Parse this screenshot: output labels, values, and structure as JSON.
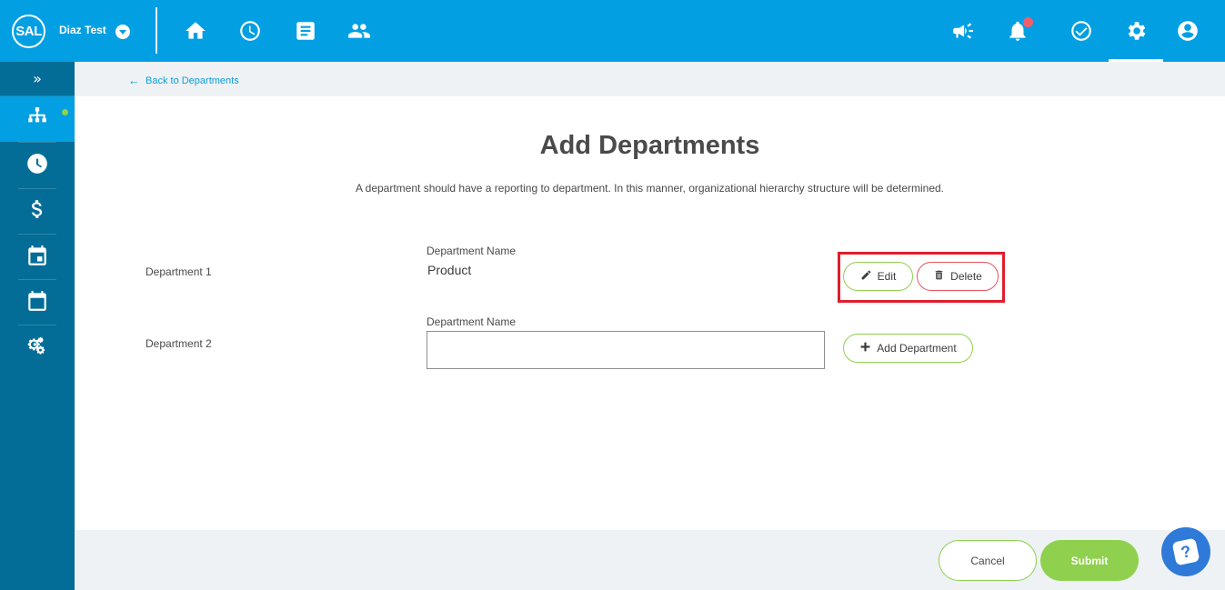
{
  "header": {
    "logo_text": "SAL",
    "company_name": "Diaz Test",
    "nav_icons": [
      "home-icon",
      "clock-icon",
      "document-icon",
      "people-icon"
    ],
    "right_icons": [
      "megaphone-icon",
      "bell-icon",
      "check-circle-icon",
      "gear-icon",
      "user-account-icon"
    ]
  },
  "sidebar": {
    "expand_label": "»",
    "items": [
      "org-chart-icon",
      "clock-icon",
      "dollar-icon",
      "calendar-day-icon",
      "calendar-icon",
      "gears-icon"
    ]
  },
  "breadcrumb": {
    "back_label": "Back to Departments",
    "arrow": "←"
  },
  "page": {
    "title": "Add Departments",
    "subtitle": "A department should have a reporting to department. In this manner, organizational hierarchy structure will be determined."
  },
  "departments": [
    {
      "label": "Department 1",
      "field_label": "Department Name",
      "value": "Product",
      "edit_label": "Edit",
      "delete_label": "Delete"
    },
    {
      "label": "Department 2",
      "field_label": "Department Name",
      "value": "",
      "add_label": "Add Department"
    }
  ],
  "footer": {
    "cancel_label": "Cancel",
    "submit_label": "Submit"
  },
  "help": {
    "glyph": "?"
  },
  "colors": {
    "header_blue": "#029fe3",
    "sidebar_blue": "#036d97",
    "accent_green": "#8fd14f",
    "highlight_red": "#e01d2c",
    "delete_red": "#e5545f",
    "link_blue": "#0d9ed9"
  }
}
